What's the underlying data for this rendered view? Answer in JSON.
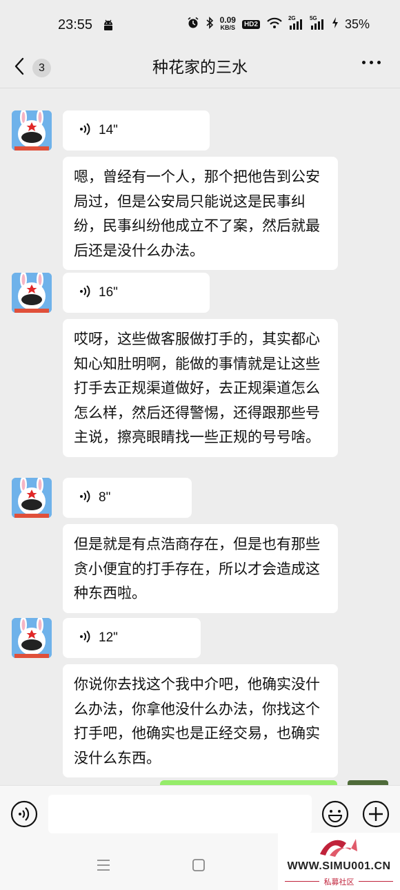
{
  "status_bar": {
    "time": "23:55",
    "net_speed_value": "0.09",
    "net_speed_unit": "KB/S",
    "hd_label": "HD2",
    "sim1_label": "2G",
    "sim2_label": "5G",
    "battery": "35%"
  },
  "header": {
    "back_badge_count": "3",
    "title": "种花家的三水"
  },
  "messages": [
    {
      "type": "voice",
      "duration": "14\""
    },
    {
      "type": "text",
      "text": "嗯，曾经有一个人，那个把他告到公安局过，但是公安局只能说这是民事纠纷，民事纠纷他成立不了案，然后就最后还是没什么办法。"
    },
    {
      "type": "voice",
      "duration": "16\""
    },
    {
      "type": "text",
      "text": "哎呀，这些做客服做打手的，其实都心知心知肚明啊，能做的事情就是让这些打手去正规渠道做好，去正规渠道怎么怎么样，然后还得警惕，还得跟那些号主说，擦亮眼睛找一些正规的号号啥。"
    },
    {
      "type": "voice",
      "duration": "8\""
    },
    {
      "type": "text",
      "text": "但是就是有点浩商存在，但是也有那些贪小便宜的打手存在，所以才会造成这种东西啦。"
    },
    {
      "type": "voice",
      "duration": "12\""
    },
    {
      "type": "text",
      "text": "你说你去找这个我中介吧，他确实没什么办法，你拿他没什么办法，你找这个打手吧，他确实也是正经交易，也确实没什么东西。"
    }
  ],
  "input_bar": {
    "text_value": ""
  },
  "watermark": {
    "url": "WWW.SIMU001.CN",
    "subtitle": "私募社区"
  },
  "colors": {
    "background": "#ededed",
    "bubble_white": "#ffffff",
    "bubble_green": "#95ec69",
    "watermark_red": "#c0223a"
  },
  "icons": [
    "android-icon",
    "alarm-icon",
    "bluetooth-icon",
    "wifi-icon",
    "signal-icon",
    "charging-icon",
    "back-chevron-icon",
    "more-icon",
    "voice-wave-icon",
    "voice-toggle-icon",
    "emoji-icon",
    "plus-icon",
    "nav-menu-icon",
    "nav-home-icon"
  ]
}
